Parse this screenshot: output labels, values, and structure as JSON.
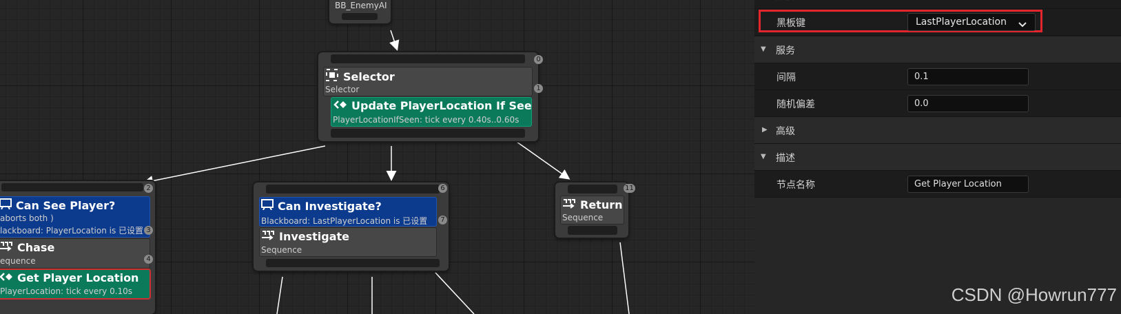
{
  "graph": {
    "blackboard_node": {
      "title": "BB_EnemyAI"
    },
    "selector_node": {
      "index": "0",
      "title": "Selector",
      "subtitle": "Selector",
      "service_index": "1",
      "service_title": "Update PlayerLocation If Seen",
      "service_subtitle": "PlayerLocationIfSeen: tick every 0.40s..0.60s"
    },
    "chase_branch": {
      "index": "2",
      "decorator_title": "Can See Player?",
      "decorator_line1": "aborts both )",
      "decorator_line2": "lackboard: PlayerLocation is 已设置",
      "decorator_index": "3",
      "seq_title": "Chase",
      "seq_subtitle": "equence",
      "seq_index": "4",
      "service_title": "Get Player Location",
      "service_subtitle": "PlayerLocation: tick every 0.10s"
    },
    "investigate_branch": {
      "index": "6",
      "decorator_title": "Can Investigate?",
      "decorator_subtitle": "Blackboard: LastPlayerLocation is 已设置",
      "decorator_index": "7",
      "seq_title": "Investigate",
      "seq_subtitle": "Sequence"
    },
    "return_node": {
      "index": "11",
      "title": "Return",
      "subtitle": "Sequence"
    }
  },
  "details": {
    "top_cut_label": "黑板",
    "blackboard_key": {
      "label": "黑板键",
      "value": "LastPlayerLocation"
    },
    "services_section": "服务",
    "interval": {
      "label": "间隔",
      "value": "0.1"
    },
    "random_deviation": {
      "label": "随机偏差",
      "value": "0.0"
    },
    "advanced_section": "高级",
    "description_section": "描述",
    "node_name": {
      "label": "节点名称",
      "value": "Get Player Location"
    }
  },
  "colors": {
    "decorator_blue": "#0c3a8c",
    "service_green": "#0a7a5b",
    "highlight_red": "#e3262d"
  },
  "watermark": "CSDN @Howrun777"
}
